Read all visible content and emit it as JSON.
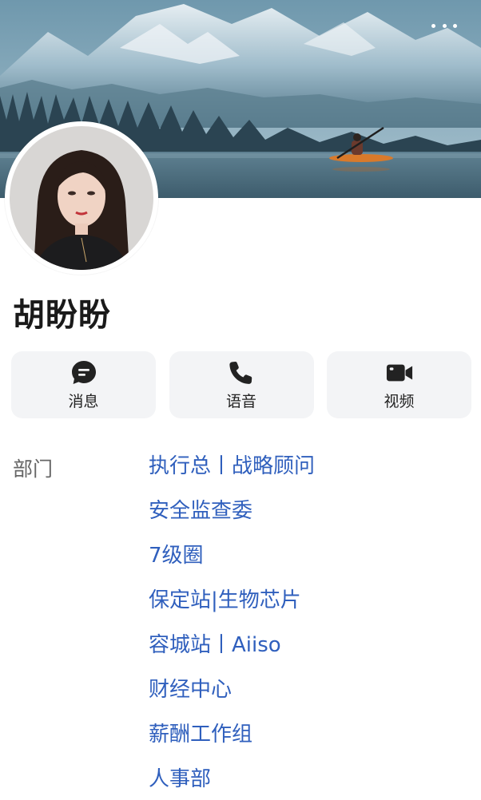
{
  "profile": {
    "name": "胡盼盼"
  },
  "actions": [
    {
      "label": "消息",
      "icon": "chat-bubble-icon"
    },
    {
      "label": "语音",
      "icon": "phone-icon"
    },
    {
      "label": "视频",
      "icon": "video-camera-icon"
    }
  ],
  "department": {
    "label": "部门",
    "items": [
      "执行总丨战略顾问",
      "安全监查委",
      "7级圈",
      "保定站|生物芯片",
      "容城站丨Aiiso",
      "财经中心",
      "薪酬工作组",
      "人事部"
    ]
  },
  "colors": {
    "link": "#2f5fbd",
    "button_bg": "#f3f4f6",
    "icon": "#222222"
  }
}
